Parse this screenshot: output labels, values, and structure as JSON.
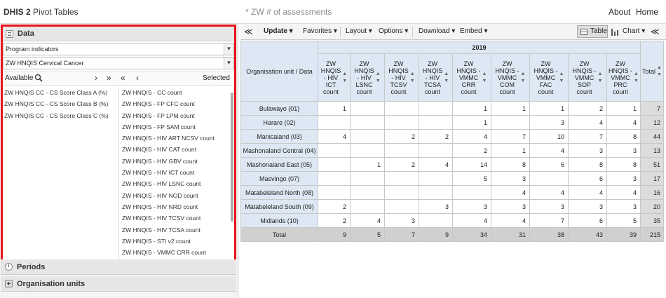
{
  "app": {
    "title_bold": "DHIS 2",
    "title_rest": " Pivot Tables"
  },
  "favorite_title": "* ZW # of assessments",
  "top_links": {
    "about": "About",
    "home": "Home"
  },
  "left": {
    "data_section": "Data",
    "data_type_select": "Program indicators",
    "program_select": "ZW HNQIS Cervical Cancer",
    "available_label": "Available",
    "selected_label": "Selected",
    "available_items": [
      "ZW HNQIS CC - CS Score Class A (%)",
      "ZW HNQIS CC - CS Score Class B (%)",
      "ZW HNQIS CC - CS Score Class C (%)"
    ],
    "selected_items": [
      "ZW HNQIS - CC count",
      "ZW HNQIS - FP CFC count",
      "ZW HNQIS - FP LPM count",
      "ZW HNQIS - FP SAM count",
      "ZW HNQIS - HIV ART NCSV count",
      "ZW HNQIS - HIV CAT count",
      "ZW HNQIS - HIV GBV count",
      "ZW HNQIS - HIV ICT count",
      "ZW HNQIS - HIV LSNC count",
      "ZW HNQIS - HIV NOD count",
      "ZW HNQIS - HIV NRD count",
      "ZW HNQIS - HIV TCSV count",
      "ZW HNQIS - HIV TCSA count",
      "ZW HNQIS - STI v2 count",
      "ZW HNQIS - VMMC CRR count"
    ],
    "periods_section": "Periods",
    "org_units_section": "Organisation units"
  },
  "toolbar": {
    "update": "Update",
    "favorites": "Favorites",
    "layout": "Layout",
    "options": "Options",
    "download": "Download",
    "embed": "Embed",
    "table": "Table",
    "chart": "Chart"
  },
  "table": {
    "year": "2019",
    "row_header": "Organisation unit / Data",
    "columns": [
      [
        "ZW",
        "HNQIS",
        "- HIV",
        "ICT",
        "count"
      ],
      [
        "ZW",
        "HNQIS",
        "- HIV",
        "LSNC",
        "count"
      ],
      [
        "ZW",
        "HNQIS",
        "- HIV",
        "TCSV",
        "count"
      ],
      [
        "ZW",
        "HNQIS",
        "- HIV",
        "TCSA",
        "count"
      ],
      [
        "ZW",
        "HNQIS -",
        "VMMC",
        "CRR",
        "count"
      ],
      [
        "ZW",
        "HNQIS -",
        "VMMC",
        "COM",
        "count"
      ],
      [
        "ZW",
        "HNQIS -",
        "VMMC",
        "FAC",
        "count"
      ],
      [
        "ZW",
        "HNQIS -",
        "VMMC",
        "SOP",
        "count"
      ],
      [
        "ZW",
        "HNQIS -",
        "VMMC",
        "PRC",
        "count"
      ]
    ],
    "total_label": "Total",
    "rows": [
      {
        "name": "Bulawayo (01)",
        "values": [
          "1",
          "",
          "",
          "",
          "1",
          "1",
          "1",
          "2",
          "1"
        ],
        "total": "7"
      },
      {
        "name": "Harare (02)",
        "values": [
          "",
          "",
          "",
          "",
          "1",
          "",
          "3",
          "4",
          "4"
        ],
        "total": "12"
      },
      {
        "name": "Manicaland (03)",
        "values": [
          "4",
          "",
          "2",
          "2",
          "4",
          "7",
          "10",
          "7",
          "8"
        ],
        "total": "44"
      },
      {
        "name": "Mashonaland Central (04)",
        "values": [
          "",
          "",
          "",
          "",
          "2",
          "1",
          "4",
          "3",
          "3"
        ],
        "total": "13"
      },
      {
        "name": "Mashonaland East (05)",
        "values": [
          "",
          "1",
          "2",
          "4",
          "14",
          "8",
          "6",
          "8",
          "8"
        ],
        "total": "51"
      },
      {
        "name": "Masvingo (07)",
        "values": [
          "",
          "",
          "",
          "",
          "5",
          "3",
          "",
          "6",
          "3"
        ],
        "total": "17"
      },
      {
        "name": "Matabeleland North (08)",
        "values": [
          "",
          "",
          "",
          "",
          "",
          "4",
          "4",
          "4",
          "4"
        ],
        "total": "16"
      },
      {
        "name": "Matabeleland South (09)",
        "values": [
          "2",
          "",
          "",
          "3",
          "3",
          "3",
          "3",
          "3",
          "3"
        ],
        "total": "20"
      },
      {
        "name": "Midlands (10)",
        "values": [
          "2",
          "4",
          "3",
          "",
          "4",
          "4",
          "7",
          "6",
          "5"
        ],
        "total": "35"
      }
    ],
    "totals": {
      "name": "Total",
      "values": [
        "9",
        "5",
        "7",
        "9",
        "34",
        "31",
        "38",
        "43",
        "39"
      ],
      "total": "215"
    }
  }
}
